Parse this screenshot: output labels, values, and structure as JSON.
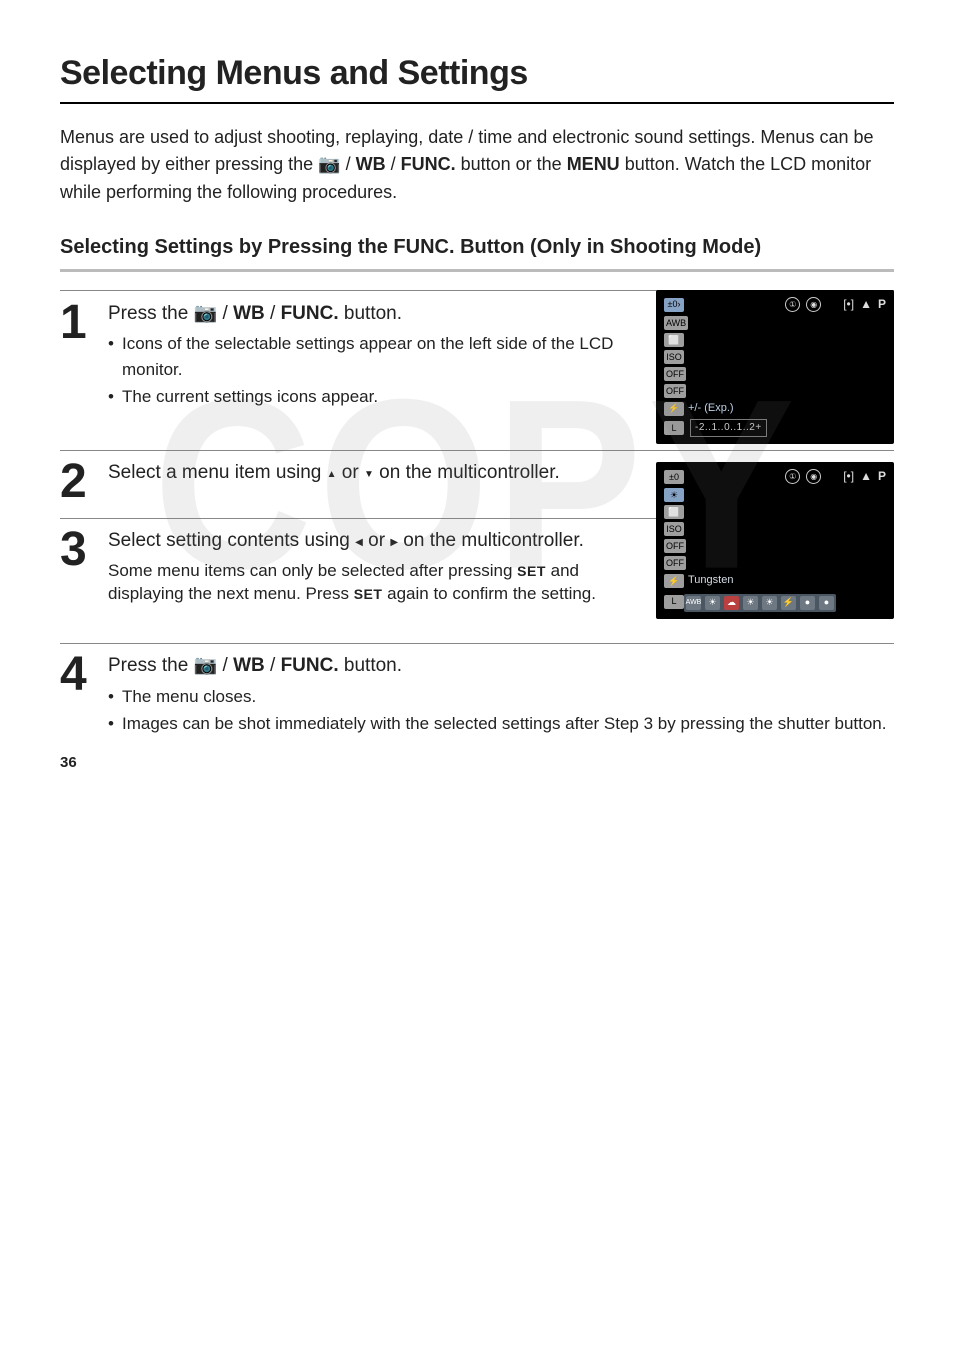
{
  "watermark": "COPY",
  "page_number": "36",
  "heading": "Selecting Menus and Settings",
  "lead_parts": {
    "a": "Menus are used to adjust shooting, replaying, date / time and electronic sound settings. Menus can be displayed by either pressing the ",
    "btn_icons": "± / WB / FUNC.",
    "b": " button or the ",
    "menu": "MENU",
    "c": " button. Watch the LCD monitor while performing the following procedures."
  },
  "subhead": {
    "a": "Selecting Settings by Pressing the ",
    "func": "FUNC.",
    "b": " Button (Only in Shooting Mode)"
  },
  "steps": {
    "s1": {
      "num": "1",
      "title_a": "Press the ",
      "title_btn": "± / WB / FUNC.",
      "title_b": " button.",
      "b1": "Icons of the selectable settings appear on the left side of the LCD monitor.",
      "b2": "The current settings icons appear."
    },
    "s2": {
      "num": "2",
      "title_a": "Select a menu item using ",
      "up": "▲",
      "mid": " or ",
      "down": "▼",
      "title_b": " on the multicontroller."
    },
    "s3": {
      "num": "3",
      "title_a": "Select setting contents using ",
      "left": "◀",
      "mid": " or ",
      "right": "▶",
      "title_b": " on the multicontroller.",
      "body_a": "Some menu items can only be selected after pressing ",
      "set1": "SET",
      "body_b": " and displaying the next menu. Press ",
      "set2": "SET",
      "body_c": " again to confirm the setting."
    },
    "s4": {
      "num": "4",
      "title_a": "Press the ",
      "title_btn": "± / WB / FUNC.",
      "title_b": " button.",
      "b1": "The menu closes.",
      "b2": "Images can be shot immediately with the selected settings after Step 3 by pressing the shutter button."
    }
  },
  "screen1": {
    "left": [
      "±0›",
      "AWB",
      "⬜",
      "ISO",
      "OFF",
      "OFF",
      "⚡",
      "L"
    ],
    "exp_label": "+/- (Exp.)",
    "scale": "-2..1..0..1..2+",
    "top": {
      "flash": "①",
      "rec": "◉",
      "meter": "[•]",
      "lock": "▲",
      "mode": "P"
    }
  },
  "screen2": {
    "left": [
      "±0",
      "☀",
      "⬜",
      "ISO",
      "OFF",
      "OFF",
      "⚡",
      "L"
    ],
    "label": "Tungsten",
    "strip": [
      "AWB",
      "☀",
      "☁",
      "☀",
      "☀",
      "⚡",
      "●",
      "●"
    ],
    "top": {
      "flash": "①",
      "rec": "◉",
      "meter": "[•]",
      "lock": "▲",
      "mode": "P"
    }
  }
}
